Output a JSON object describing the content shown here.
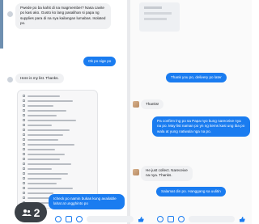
{
  "left_chat": {
    "messages": [
      {
        "type": "received",
        "text": "Pwede po ba kahit di na magmember? Nasa cavite po kasi ako. Gusto ko lang pasalihan si papa ng supplies para di na nya kailangan lumabas. Isolated po."
      },
      {
        "type": "sent",
        "text": "Ok po sige po"
      },
      {
        "type": "received",
        "text": "Here is my list. Thanks."
      },
      {
        "type": "sent",
        "text": "Icheck po namin bukas kung available lahat at ungghinto po"
      }
    ],
    "participants_count": "2"
  },
  "right_chat": {
    "messages": [
      {
        "type": "sent",
        "text": "Thank you po, delivery po later"
      },
      {
        "type": "received",
        "text": "Thanks!"
      },
      {
        "type": "sent",
        "text": "Pa confirm lng po sa Papa nyo kung nareceive nya na po. May list naman po yn ng items kasi ung iba po wala at yung natiwala nga na po."
      },
      {
        "type": "received",
        "text": "He just collect. Nareceive na nya. Thanks."
      },
      {
        "type": "sent",
        "text": "Salamat din po. Hanggang sa uulitin"
      }
    ]
  },
  "colors": {
    "sent_bubble": "#1a7cf0",
    "received_bubble": "#f0f1f3",
    "badge": "#3b4046"
  },
  "icons": [
    "participants-icon",
    "camera-icon",
    "image-icon",
    "sticker-icon",
    "gif-icon",
    "like-icon"
  ]
}
